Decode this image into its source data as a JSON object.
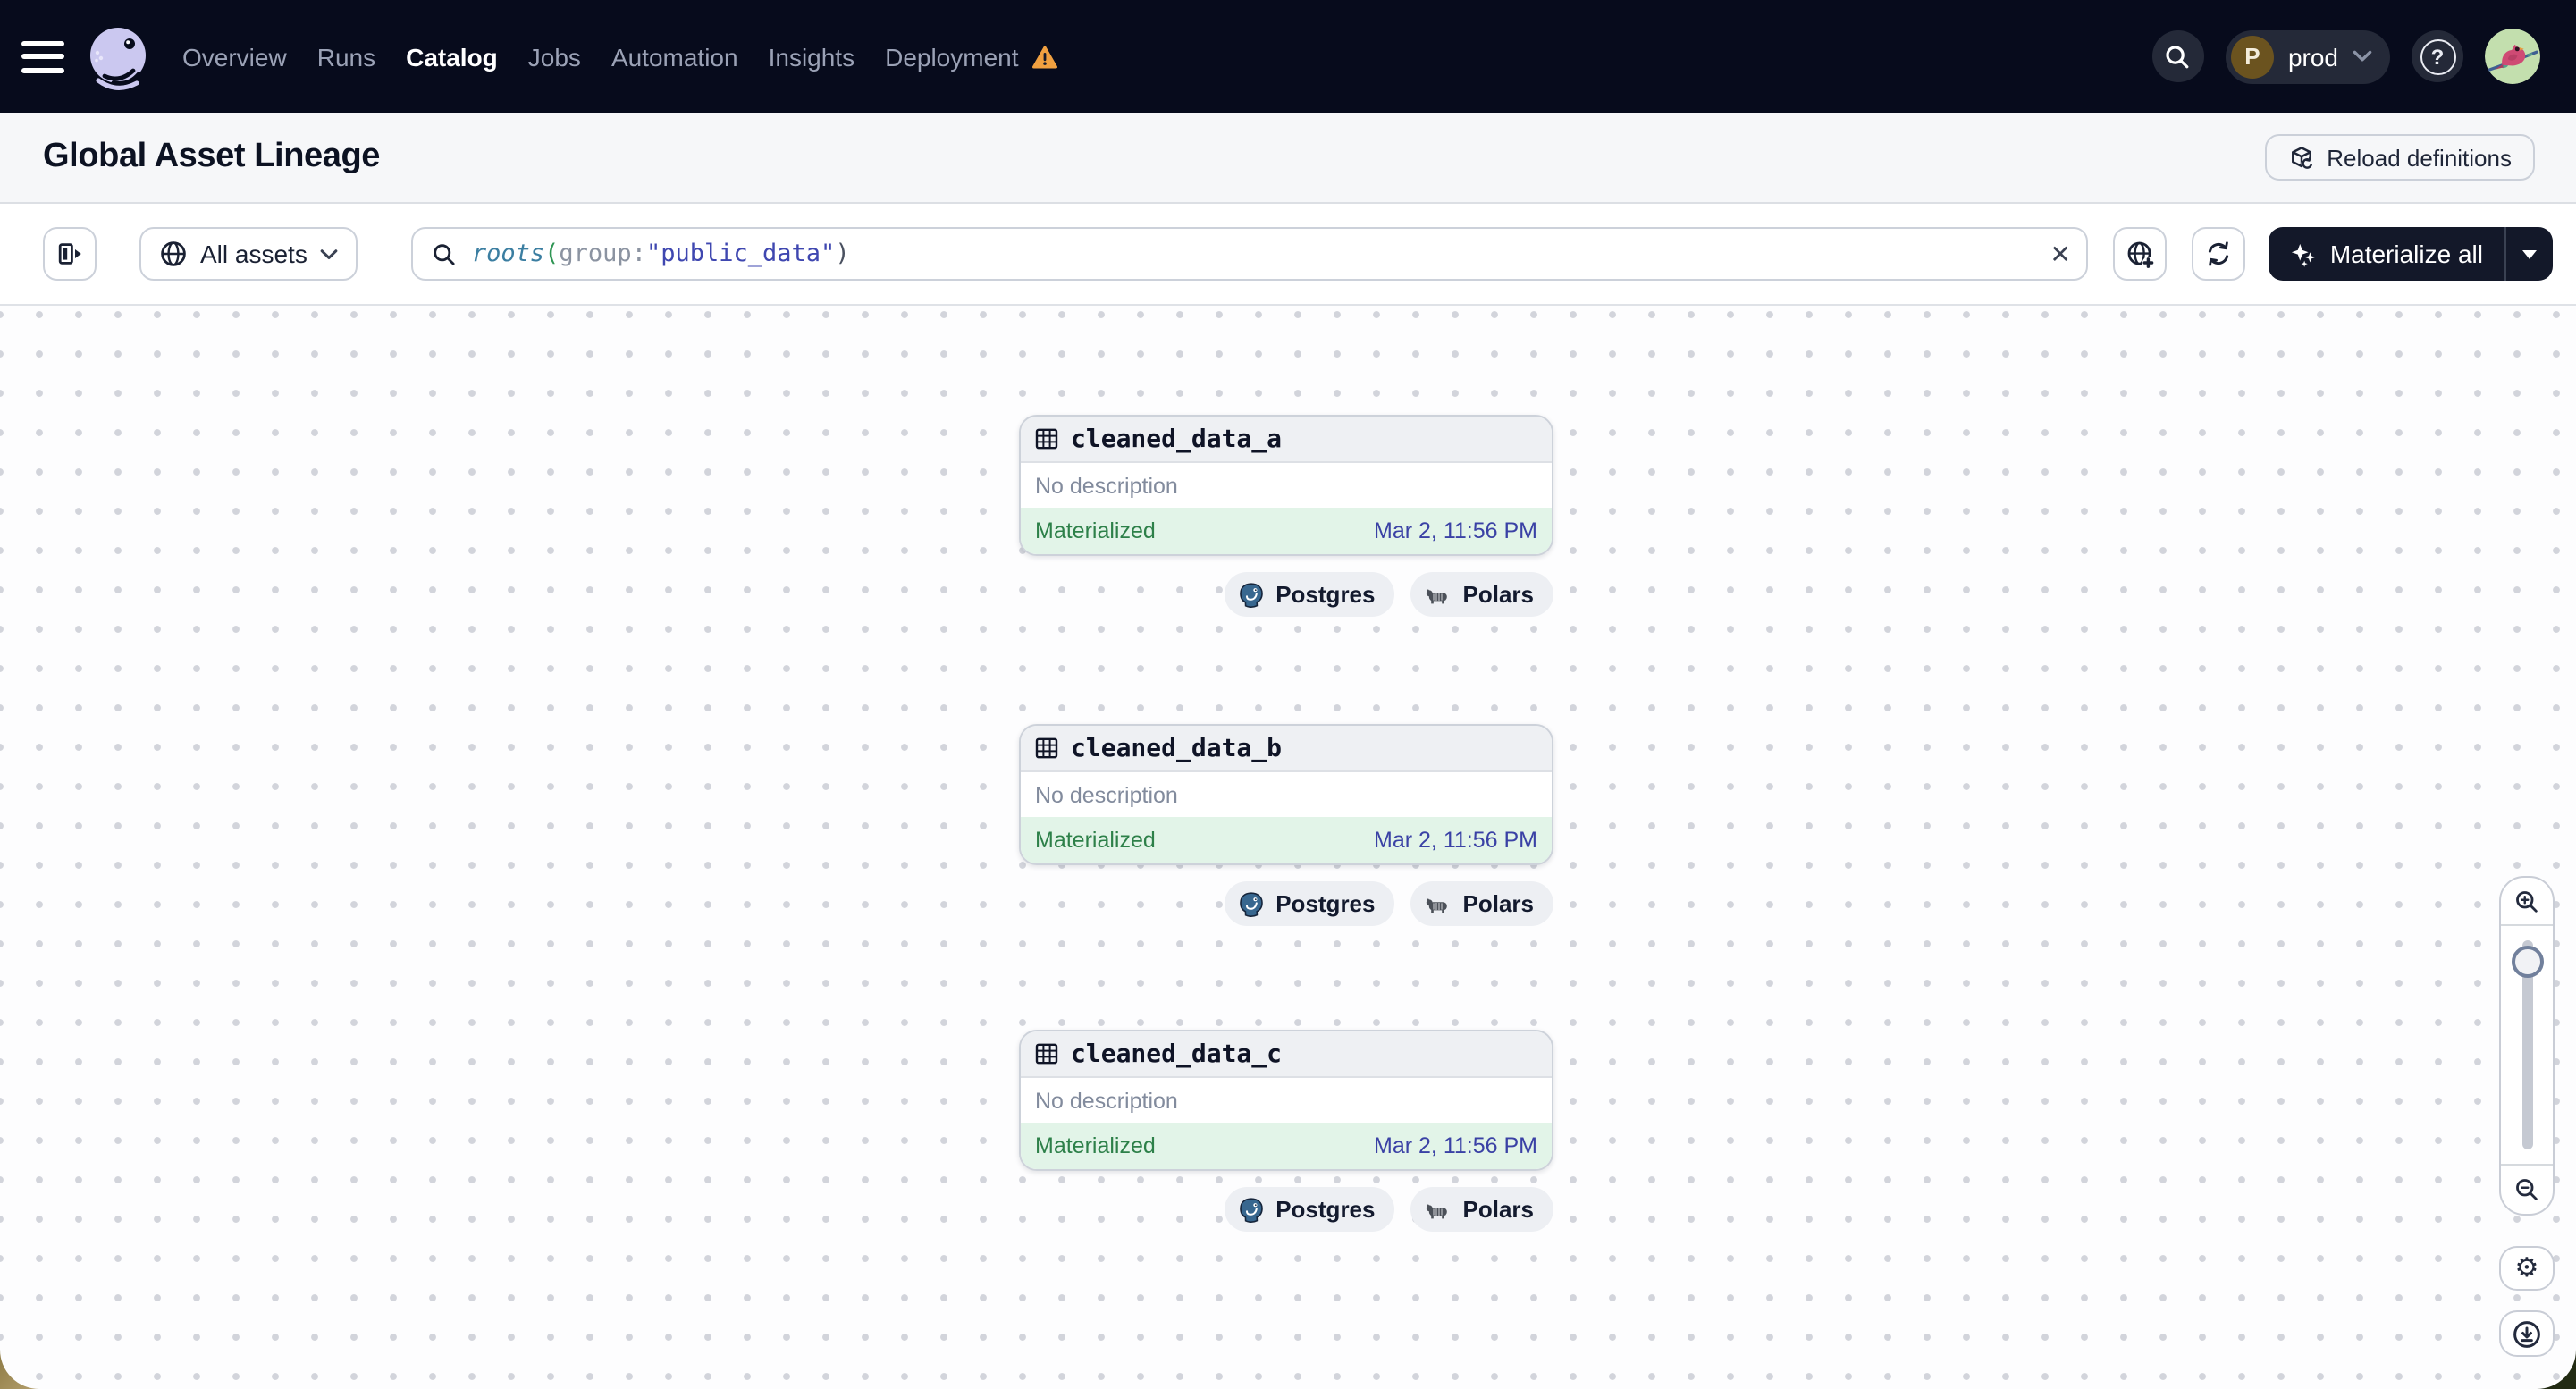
{
  "navbar": {
    "items": [
      {
        "label": "Overview",
        "active": false
      },
      {
        "label": "Runs",
        "active": false
      },
      {
        "label": "Catalog",
        "active": true
      },
      {
        "label": "Jobs",
        "active": false
      },
      {
        "label": "Automation",
        "active": false
      },
      {
        "label": "Insights",
        "active": false
      },
      {
        "label": "Deployment",
        "active": false,
        "warning": true
      }
    ],
    "environment": {
      "initial": "P",
      "name": "prod"
    }
  },
  "header": {
    "title": "Global Asset Lineage",
    "reload_label": "Reload definitions"
  },
  "toolbar": {
    "scope_label": "All assets",
    "materialize_label": "Materialize all",
    "query": {
      "full": "roots(group:\"public_data\")",
      "fn": "roots",
      "open": "(",
      "key": "group",
      "colon": ":",
      "string": "\"public_data\"",
      "close": ")"
    }
  },
  "nodes": [
    {
      "name": "cleaned_data_a",
      "description": "No description",
      "status": "Materialized",
      "timestamp": "Mar 2, 11:56 PM",
      "tags": [
        "Postgres",
        "Polars"
      ]
    },
    {
      "name": "cleaned_data_b",
      "description": "No description",
      "status": "Materialized",
      "timestamp": "Mar 2, 11:56 PM",
      "tags": [
        "Postgres",
        "Polars"
      ]
    },
    {
      "name": "cleaned_data_c",
      "description": "No description",
      "status": "Materialized",
      "timestamp": "Mar 2, 11:56 PM",
      "tags": [
        "Postgres",
        "Polars"
      ]
    }
  ],
  "icons": {
    "clear": "✕",
    "question": "?",
    "gear": "⚙"
  },
  "colors": {
    "nav_bg": "#070b1c",
    "accent_dark": "#131829",
    "status_green": "#2d8049",
    "status_green_bg": "#e2f4e8",
    "timestamp_blue": "#3a41a5",
    "query_fn": "#3b7ea1",
    "query_string": "#3f47b0",
    "query_paren_open": "#2e9553",
    "muted_text": "#828b9d",
    "warning_orange": "#f0a040",
    "postgres_blue": "#38678f",
    "env_badge_brown": "#6b531f",
    "avatar_green": "#c3dfae"
  }
}
